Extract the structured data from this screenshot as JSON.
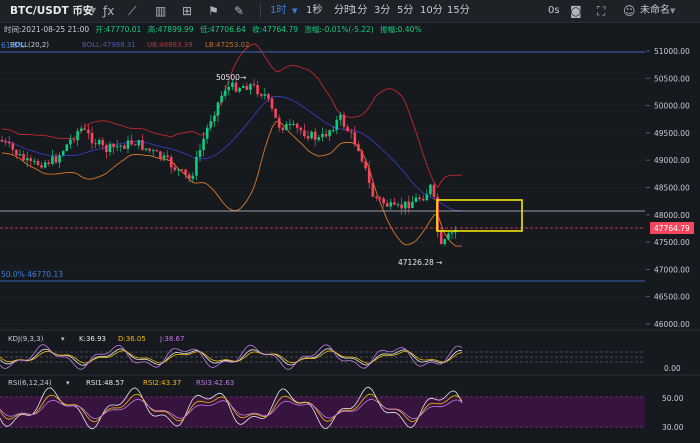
{
  "toolbar": {
    "pair": "BTC/USDT 币安",
    "intervals": [
      "1时",
      "1秒",
      "分时",
      "1分",
      "3分",
      "5分",
      "10分",
      "15分"
    ],
    "active_interval": "1时",
    "right_label": "0s",
    "account": "未命名"
  },
  "info": {
    "time": "时间:2021-08-25 21:00",
    "open": "开:47770.01",
    "high": "高:47899.99",
    "low": "低:47706.64",
    "close": "收:47764.79",
    "change": "涨幅:-0.01%(-5.22)",
    "amplitude": "振幅:0.40%"
  },
  "boll": {
    "label": "BOLL(20,2)",
    "mid": "BOLL:47968.31",
    "ub": "UB:48683.39",
    "lb": "LB:47253.02"
  },
  "fib": {
    "top_label": "61.8%",
    "bottom_label": "50.0% 46770.13"
  },
  "annotations": {
    "high": "50500",
    "low": "47126.28"
  },
  "price_axis": [
    "51000.00",
    "50500.00",
    "50000.00",
    "49500.00",
    "49000.00",
    "48500.00",
    "48000.00",
    "47500.00",
    "47000.00",
    "46500.00",
    "46000.00"
  ],
  "current_price": "47764.79",
  "kdj": {
    "label": "KDJ(9,3,3)",
    "k": "K:36.93",
    "d": "D:36.05",
    "j": "J:38.67",
    "axis": "0.00"
  },
  "rsi": {
    "label": "RSI(6,12,24)",
    "rsi1": "RSI1:48.57",
    "rsi2": "RSI2:43.37",
    "rsi3": "RSI3:42.63",
    "axis": [
      "50.00",
      "30.00"
    ]
  },
  "colors": {
    "up": "#0ecb81",
    "down": "#f6465d",
    "highlight_box": "#f5e60a",
    "accent": "#3d7fe0"
  }
}
